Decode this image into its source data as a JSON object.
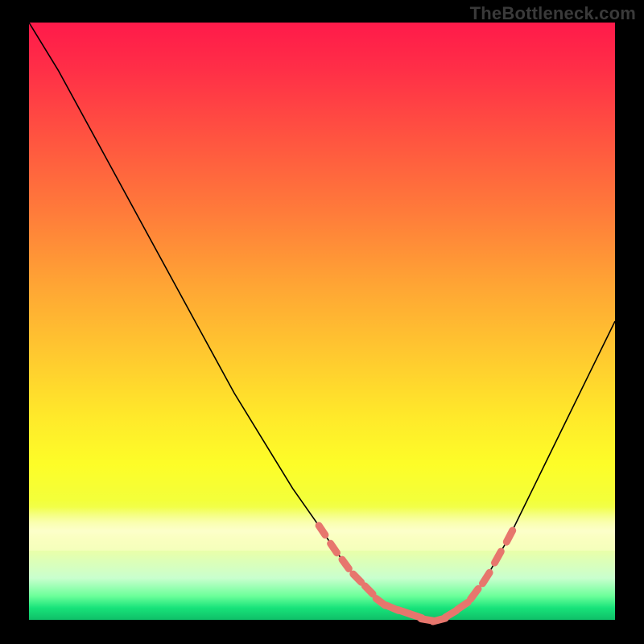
{
  "watermark": "TheBottleneck.com",
  "colors": {
    "frame": "#000000",
    "curve": "#000000",
    "marker": "#e7766d",
    "gradient_top": "#ff1a4a",
    "gradient_bottom": "#0fbf68"
  },
  "chart_data": {
    "type": "line",
    "title": "",
    "xlabel": "",
    "ylabel": "",
    "xlim": [
      0,
      100
    ],
    "ylim": [
      0,
      100
    ],
    "x": [
      0,
      5,
      10,
      15,
      20,
      25,
      30,
      35,
      40,
      45,
      50,
      52,
      55,
      58,
      60,
      62,
      65,
      68,
      70,
      72,
      75,
      78,
      82,
      86,
      90,
      95,
      100
    ],
    "y": [
      100,
      92,
      83,
      74,
      65,
      56,
      47,
      38,
      30,
      22,
      15,
      12,
      8,
      5,
      3,
      2,
      1,
      0,
      0,
      1,
      3,
      7,
      14,
      22,
      30,
      40,
      50
    ],
    "valley_x_range": [
      58,
      74
    ],
    "markers": {
      "left_segment_x": [
        50,
        52,
        54,
        56,
        58,
        60
      ],
      "bottom_segment_x": [
        62,
        64,
        66,
        68,
        70,
        72
      ],
      "right_segment_x": [
        74,
        76,
        78,
        80,
        82
      ]
    }
  }
}
